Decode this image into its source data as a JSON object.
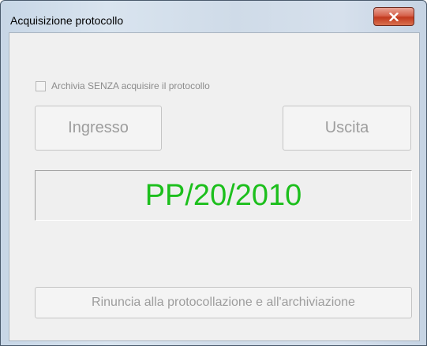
{
  "window": {
    "title": "Acquisizione protocollo"
  },
  "titlebar": {
    "close_icon": "close-x-icon"
  },
  "options": {
    "archive_without_protocol_label": "Archivia SENZA acquisire il protocollo",
    "archive_without_protocol_checked": false
  },
  "buttons": {
    "ingresso_label": "Ingresso",
    "uscita_label": "Uscita",
    "rinuncia_label": "Rinuncia alla protocollazione e all'archiviazione"
  },
  "protocol": {
    "number": "PP/20/2010"
  },
  "colors": {
    "protocol_text": "#1cbf1c",
    "disabled_text": "#9d9d9d",
    "close_button": "#c1391e"
  }
}
